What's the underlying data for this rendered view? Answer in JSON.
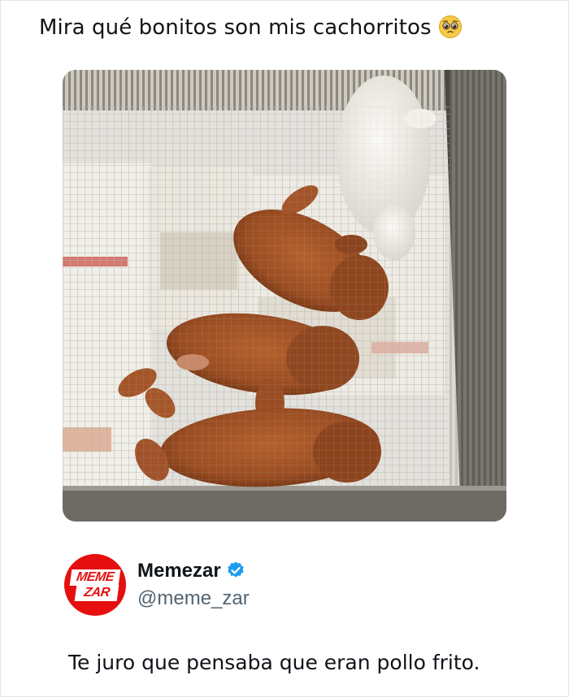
{
  "post": {
    "caption": "Mira qué bonitos son mis cachorritos",
    "caption_emoji": "pleading-face-emoji"
  },
  "tweet": {
    "author_name": "Memezar",
    "author_handle": "@meme_zar",
    "verified": true,
    "avatar_text_line1": "MEME",
    "avatar_text_line2": "ZAR",
    "text": "Te juro que pensaba que eran pollo frito."
  },
  "colors": {
    "brand_red": "#e60f0f",
    "verified_blue": "#1d9bf0",
    "handle_gray": "#536471"
  }
}
